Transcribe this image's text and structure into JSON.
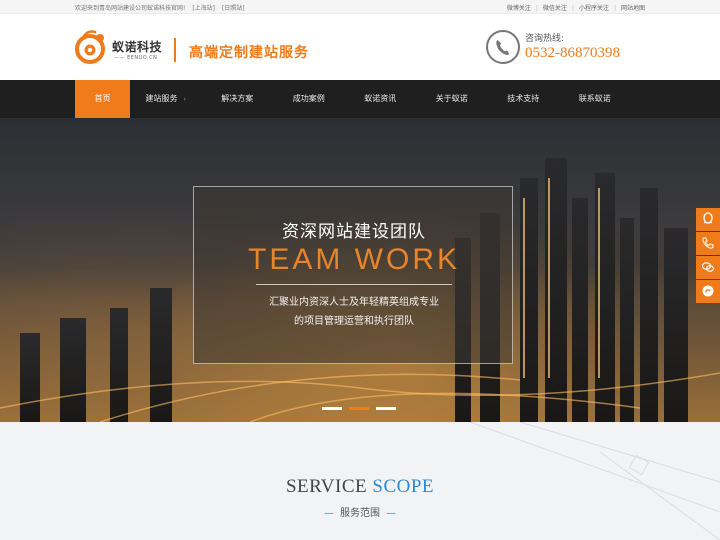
{
  "topbar": {
    "welcome": "欢迎来到青岛网站建设公司蚁诺科技官网!",
    "branch_shanghai": "[上海站]",
    "branch_rizhao": "[日照站]",
    "links": [
      "微博关注",
      "微信关注",
      "小程序关注",
      "网站地图"
    ]
  },
  "header": {
    "logo_name": "蚁诺科技",
    "logo_domain": "—— EENUO.CN",
    "slogan": "高端定制建站服务",
    "hotline_label": "咨询热线:",
    "hotline_number": "0532-86870398"
  },
  "nav": {
    "items": [
      {
        "label": "首页"
      },
      {
        "label": "建站服务"
      },
      {
        "label": "解决方案"
      },
      {
        "label": "成功案例"
      },
      {
        "label": "蚁诺资讯"
      },
      {
        "label": "关于蚁诺"
      },
      {
        "label": "技术支持"
      },
      {
        "label": "联系蚁诺"
      }
    ],
    "active_index": 0,
    "dropdown_arrow": "›"
  },
  "banner": {
    "title": "资深网站建设团队",
    "subtitle_en": "TEAM WORK",
    "desc_line1": "汇聚业内资深人士及年轻精英组成专业",
    "desc_line2": "的项目管理运营和执行团队",
    "slides": 3,
    "active_slide": 1
  },
  "float_icons": [
    "qq-icon",
    "phone-icon",
    "wechat-icon",
    "miniprogram-icon"
  ],
  "service": {
    "title_en_1": "SERVICE",
    "title_en_2": "SCOPE",
    "title_cn": "服务范围",
    "dash": "—"
  },
  "colors": {
    "accent": "#f07b1a",
    "nav_bg": "#1f1f1f",
    "service_blue": "#2a8ad6"
  }
}
